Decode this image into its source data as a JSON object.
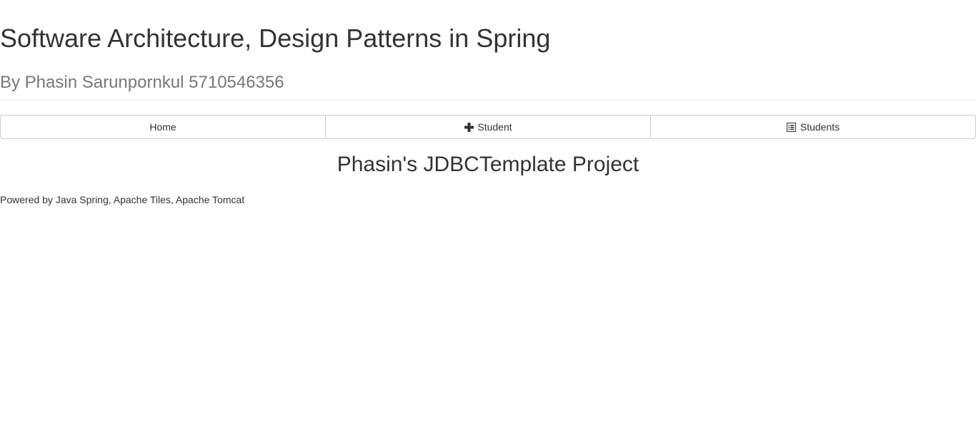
{
  "header": {
    "title": "Software Architecture, Design Patterns in Spring",
    "subtitle": "By Phasin Sarunpornkul 5710546356"
  },
  "nav": {
    "home_label": "Home",
    "add_student_label": "Student",
    "students_label": "Students",
    "add_icon": "plus-icon",
    "list_icon": "list-alt-icon"
  },
  "main": {
    "title": "Phasin's JDBCTemplate Project"
  },
  "footer": {
    "text": "Powered by Java Spring, Apache Tiles, Apache Tomcat"
  }
}
